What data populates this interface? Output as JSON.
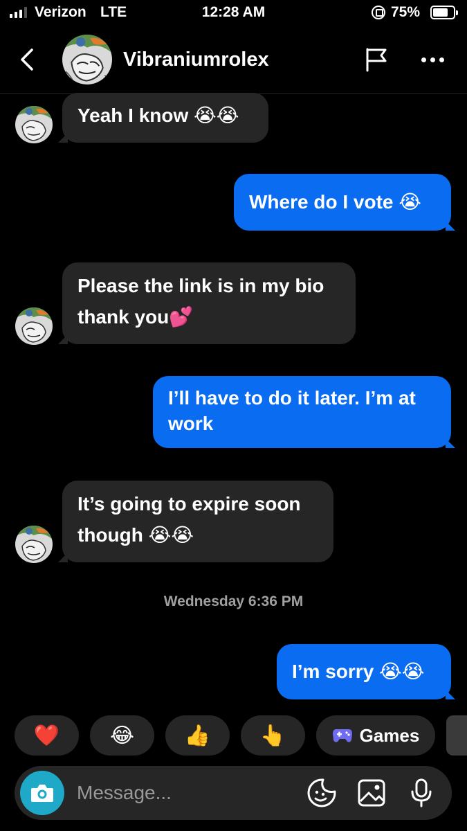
{
  "status_bar": {
    "carrier": "Verizon",
    "network": "LTE",
    "time": "12:28 AM",
    "battery_percent": "75%",
    "battery_level": 0.75,
    "icons": [
      "signal-icon",
      "rotation-lock-icon",
      "battery-icon"
    ]
  },
  "header": {
    "contact_name": "Vibraniumrolex",
    "icons": [
      "back-chevron-icon",
      "flag-icon",
      "more-dots-icon"
    ]
  },
  "messages": [
    {
      "direction": "incoming",
      "text": "Yeah I know 😭😭"
    },
    {
      "direction": "outgoing",
      "text": "Where do I vote 😭"
    },
    {
      "direction": "incoming",
      "text": "Please the link is in my bio thank you💕"
    },
    {
      "direction": "outgoing",
      "text": "I’ll have to do it later. I’m at work"
    },
    {
      "direction": "incoming",
      "text": "It’s going to expire soon though 😭😭"
    },
    {
      "direction": "outgoing",
      "text": "I’m sorry 😭😭"
    }
  ],
  "timestamp": "Wednesday 6:36 PM",
  "quick_replies": [
    {
      "label": "❤️",
      "icon": "heart-emoji"
    },
    {
      "label": "😂",
      "icon": "laughing-emoji"
    },
    {
      "label": "👍",
      "icon": "thumbs-up-emoji"
    },
    {
      "label": "👆",
      "icon": "pointing-up-emoji"
    },
    {
      "label": "Games",
      "icon": "gamepad-icon"
    }
  ],
  "composer": {
    "placeholder": "Message...",
    "icons": [
      "camera-icon",
      "sticker-icon",
      "gallery-icon",
      "microphone-icon"
    ]
  },
  "colors": {
    "background": "#000000",
    "incoming_bubble": "#262626",
    "outgoing_bubble": "#0a6cf0",
    "camera_button": "#1fa9c9",
    "timestamp_text": "#a0a0a0"
  }
}
